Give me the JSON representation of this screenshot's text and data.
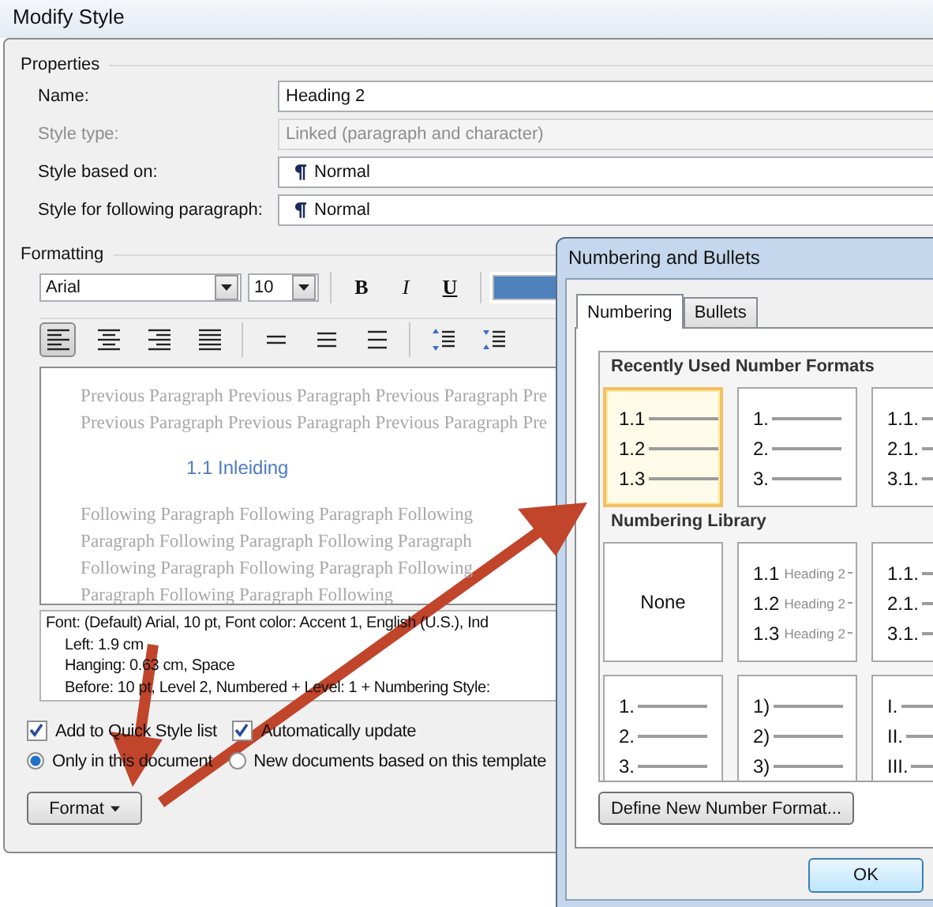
{
  "window": {
    "title": "Modify Style"
  },
  "properties": {
    "heading": "Properties",
    "fields": [
      {
        "label": "Name:",
        "value": "Heading 2",
        "kind": "text",
        "disabled": false
      },
      {
        "label": "Style type:",
        "value": "Linked (paragraph and character)",
        "kind": "text",
        "disabled": true
      },
      {
        "label": "Style based on:",
        "value": "Normal",
        "kind": "style",
        "disabled": false
      },
      {
        "label": "Style for following paragraph:",
        "value": "Normal",
        "kind": "style",
        "disabled": false
      }
    ]
  },
  "formatting": {
    "heading": "Formatting",
    "font": "Arial",
    "size": "10",
    "char_buttons": [
      {
        "kind": "bold",
        "label": "B"
      },
      {
        "kind": "italic",
        "label": "I"
      },
      {
        "kind": "underline",
        "label": "U"
      }
    ],
    "paragraph_buttons": [
      {
        "kind": "align-left",
        "selected": true
      },
      {
        "kind": "align-center",
        "selected": false
      },
      {
        "kind": "align-right",
        "selected": false
      },
      {
        "kind": "justify",
        "selected": false
      },
      {
        "kind": "spacing-single",
        "selected": false
      },
      {
        "kind": "spacing-one-half",
        "selected": false
      },
      {
        "kind": "spacing-double",
        "selected": false
      },
      {
        "kind": "space-increase",
        "selected": false
      },
      {
        "kind": "space-decrease",
        "selected": false
      }
    ]
  },
  "preview": {
    "previous": [
      "Previous Paragraph Previous Paragraph Previous Paragraph Pre",
      "Previous Paragraph Previous Paragraph Previous Paragraph Pre"
    ],
    "heading": "1.1 Inleiding",
    "following": [
      "Following Paragraph Following Paragraph Following",
      "Paragraph Following Paragraph Following Paragraph",
      "Following Paragraph Following Paragraph Following",
      "Paragraph Following Paragraph Following"
    ]
  },
  "description": [
    "Font: (Default) Arial, 10 pt, Font color: Accent 1, English (U.S.), Ind",
    "Left:  1.9 cm",
    "Hanging:  0.63 cm, Space",
    "Before:  10 pt, Level 2, Numbered + Level: 1 + Numbering Style:"
  ],
  "checkboxes": [
    {
      "label": "Add to Quick Style list",
      "checked": true
    },
    {
      "label": "Automatically update",
      "checked": true
    }
  ],
  "radios": [
    {
      "label": "Only in this document",
      "selected": true
    },
    {
      "label": "New documents based on this template",
      "selected": false
    }
  ],
  "format_button": "Format",
  "numbering_dialog": {
    "title": "Numbering and Bullets",
    "tabs": [
      {
        "label": "Numbering",
        "selected": true
      },
      {
        "label": "Bullets",
        "selected": false
      }
    ],
    "sections": [
      {
        "heading": "Recently Used Number Formats",
        "cells": [
          {
            "kind": "list",
            "selected": true,
            "lines": [
              {
                "number": "1.1"
              },
              {
                "number": "1.2"
              },
              {
                "number": "1.3"
              }
            ]
          },
          {
            "kind": "list",
            "selected": false,
            "lines": [
              {
                "number": "1."
              },
              {
                "number": "2."
              },
              {
                "number": "3."
              }
            ]
          },
          {
            "kind": "list",
            "selected": false,
            "lines": [
              {
                "number": "1.1."
              },
              {
                "number": "2.1."
              },
              {
                "number": "3.1."
              }
            ]
          }
        ]
      },
      {
        "heading": "Numbering Library",
        "cells": [
          {
            "kind": "none",
            "selected": false,
            "label": "None"
          },
          {
            "kind": "list",
            "selected": false,
            "lines": [
              {
                "number": "1.1",
                "label": "Heading 2"
              },
              {
                "number": "1.2",
                "label": "Heading 2"
              },
              {
                "number": "1.3",
                "label": "Heading 2"
              }
            ]
          },
          {
            "kind": "list",
            "selected": false,
            "lines": [
              {
                "number": "1.1."
              },
              {
                "number": "2.1."
              },
              {
                "number": "3.1."
              }
            ]
          },
          {
            "kind": "list",
            "selected": false,
            "lines": [
              {
                "number": "1."
              },
              {
                "number": "2."
              },
              {
                "number": "3."
              }
            ]
          },
          {
            "kind": "list",
            "selected": false,
            "lines": [
              {
                "number": "1)"
              },
              {
                "number": "2)"
              },
              {
                "number": "3)"
              }
            ]
          },
          {
            "kind": "list",
            "selected": false,
            "lines": [
              {
                "number": "I."
              },
              {
                "number": "II."
              },
              {
                "number": "III."
              }
            ]
          }
        ]
      }
    ],
    "define_button": "Define New Number Format...",
    "ok_button": "OK"
  }
}
